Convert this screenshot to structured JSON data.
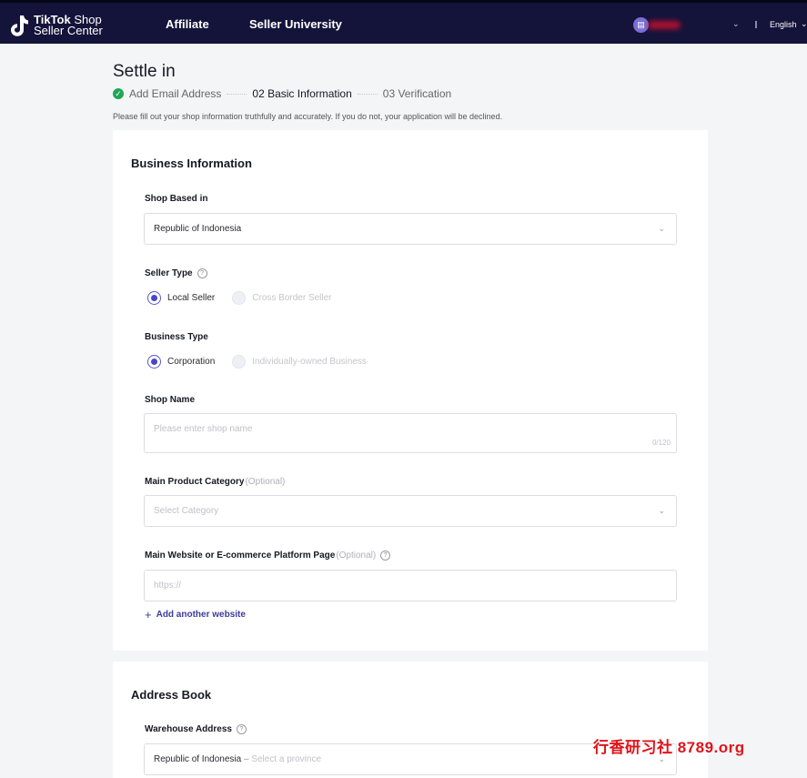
{
  "topbar": {
    "logo_line1_bold": "TikTok",
    "logo_line1_rest": " Shop",
    "logo_line2": "Seller Center",
    "nav": [
      "Affiliate",
      "Seller University"
    ],
    "language": "English",
    "bg_color": "#14133a"
  },
  "header": {
    "title": "Settle in",
    "steps": [
      {
        "label": "Add Email Address",
        "status": "done"
      },
      {
        "label": "02 Basic Information",
        "status": "active"
      },
      {
        "label": "03 Verification",
        "status": "pending"
      }
    ],
    "note": "Please fill out your shop information truthfully and accurately. If you do not, your application will be declined."
  },
  "business": {
    "title": "Business Information",
    "shop_based_in": {
      "label": "Shop Based in",
      "value": "Republic of Indonesia"
    },
    "seller_type": {
      "label": "Seller Type",
      "options": [
        "Local Seller",
        "Cross Border Seller"
      ],
      "selected": "Local Seller"
    },
    "business_type": {
      "label": "Business Type",
      "options": [
        "Corporation",
        "Individually-owned Business"
      ],
      "selected": "Corporation"
    },
    "shop_name": {
      "label": "Shop Name",
      "placeholder": "Please enter shop name",
      "counter": "0/120"
    },
    "category": {
      "label": "Main Product Category",
      "optional": "(Optional)",
      "placeholder": "Select Category"
    },
    "website": {
      "label": "Main Website or E-commerce Platform Page",
      "optional": "(Optional)",
      "placeholder": "https://"
    },
    "add_website": "Add another website"
  },
  "address": {
    "title": "Address Book",
    "warehouse": {
      "label": "Warehouse Address",
      "country": "Republic of Indonesia",
      "separator": " – ",
      "placeholder": "Select a province"
    }
  },
  "watermark": "行香研习社 8789.org",
  "colors": {
    "accent": "#4a45c9",
    "success": "#1fa656",
    "link": "#3c3c9c"
  }
}
